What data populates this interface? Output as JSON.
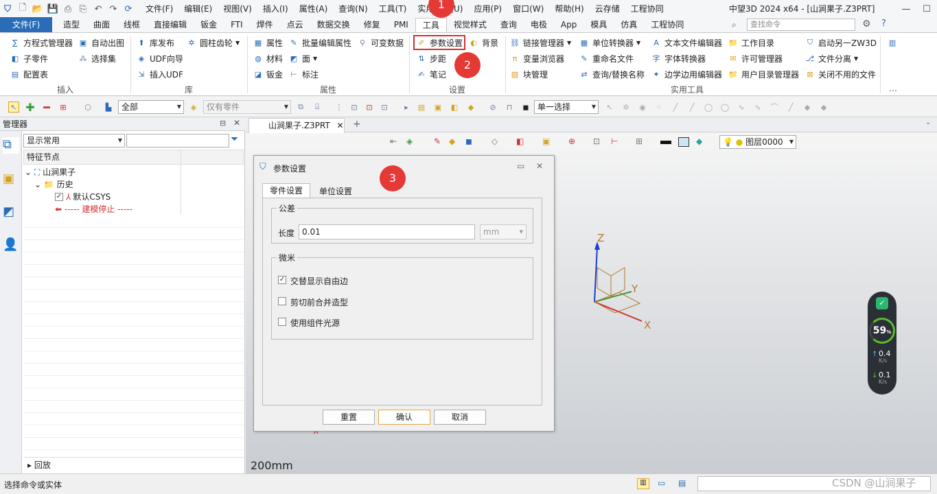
{
  "quick_access": {
    "icons": [
      "app-logo-icon",
      "new-icon",
      "open-icon",
      "save-icon",
      "print-icon",
      "print-preview-icon",
      "undo-icon",
      "redo-icon",
      "refresh-icon"
    ]
  },
  "menu": [
    "文件(F)",
    "编辑(E)",
    "视图(V)",
    "插入(I)",
    "属性(A)",
    "查询(N)",
    "工具(T)",
    "实用工具(U)",
    "应用(P)",
    "窗口(W)",
    "帮助(H)",
    "云存储",
    "工程协同"
  ],
  "window_title": "中望3D 2024 x64 - [山涧果子.Z3PRT]",
  "tabs": [
    "文件(F)",
    "造型",
    "曲面",
    "线框",
    "直接编辑",
    "钣金",
    "FTI",
    "焊件",
    "点云",
    "数据交换",
    "修复",
    "PMI",
    "工具",
    "视觉样式",
    "查询",
    "电极",
    "App",
    "模具",
    "仿真",
    "工程协同"
  ],
  "active_tab": "工具",
  "search_placeholder": "查找命令",
  "ribbon": {
    "insert": {
      "items": [
        "方程式管理器",
        "自动出图",
        "子零件",
        "选择集",
        "配置表"
      ],
      "label": "插入"
    },
    "library": {
      "items": [
        "库发布",
        "圆柱齿轮",
        "UDF向导",
        "插入UDF"
      ],
      "label": "库"
    },
    "properties": {
      "items": [
        "属性",
        "批量编辑属性",
        "可变数据",
        "材料",
        "面",
        "钣金",
        "标注"
      ],
      "label": "属性"
    },
    "settings": {
      "items": [
        "参数设置",
        "背景",
        "步距",
        "笔记"
      ],
      "label": "设置"
    },
    "utilities": {
      "items": [
        "链接管理器",
        "单位转换器",
        "文本文件编辑器",
        "工作目录",
        "启动另一ZW3D",
        "变量浏览器",
        "重命名文件",
        "字体转换器",
        "许可管理器",
        "文件分离",
        "块管理",
        "查询/替换名称",
        "边学边用编辑器",
        "用户目录管理器",
        "关闭不用的文件"
      ],
      "label": "实用工具"
    }
  },
  "toolbar2": {
    "filter_value": "全部",
    "only_parts": "仅有零件",
    "select_mode": "单一选择"
  },
  "manager": {
    "title": "管理器",
    "display_combo": "显示常用",
    "column_header": "特征节点",
    "tree": [
      "山涧果子",
      "历史",
      "默认CSYS",
      "----- 建模停止 -----"
    ],
    "footer": "回放"
  },
  "doc_tab": "山涧果子.Z3PRT",
  "layer": "图层0000",
  "dialog": {
    "title": "参数设置",
    "tabs": [
      "零件设置",
      "单位设置"
    ],
    "tolerance_group": "公差",
    "length_label": "长度",
    "length_value": "0.01",
    "unit": "mm",
    "misc_group": "微米",
    "checkboxes": [
      {
        "label": "交替显示自由边",
        "checked": true
      },
      {
        "label": "剪切前合并造型",
        "checked": false
      },
      {
        "label": "使用组件光源",
        "checked": false
      }
    ],
    "reset": "重置",
    "ok": "确认",
    "cancel": "取消"
  },
  "axes": {
    "x": "X",
    "y": "Y",
    "z": "Z"
  },
  "scale_label": "200mm",
  "perf": {
    "percent": "59",
    "pct_sign": "%",
    "up": "0.4",
    "down": "0.1",
    "unit": "K/s"
  },
  "status_text": "选择命令或实体",
  "watermark": "CSDN @山涧果子",
  "badges": [
    "1",
    "2",
    "3"
  ],
  "colors": {
    "accent": "#2b6cb8",
    "badge": "#e53935",
    "highlight": "#d32f2f"
  }
}
